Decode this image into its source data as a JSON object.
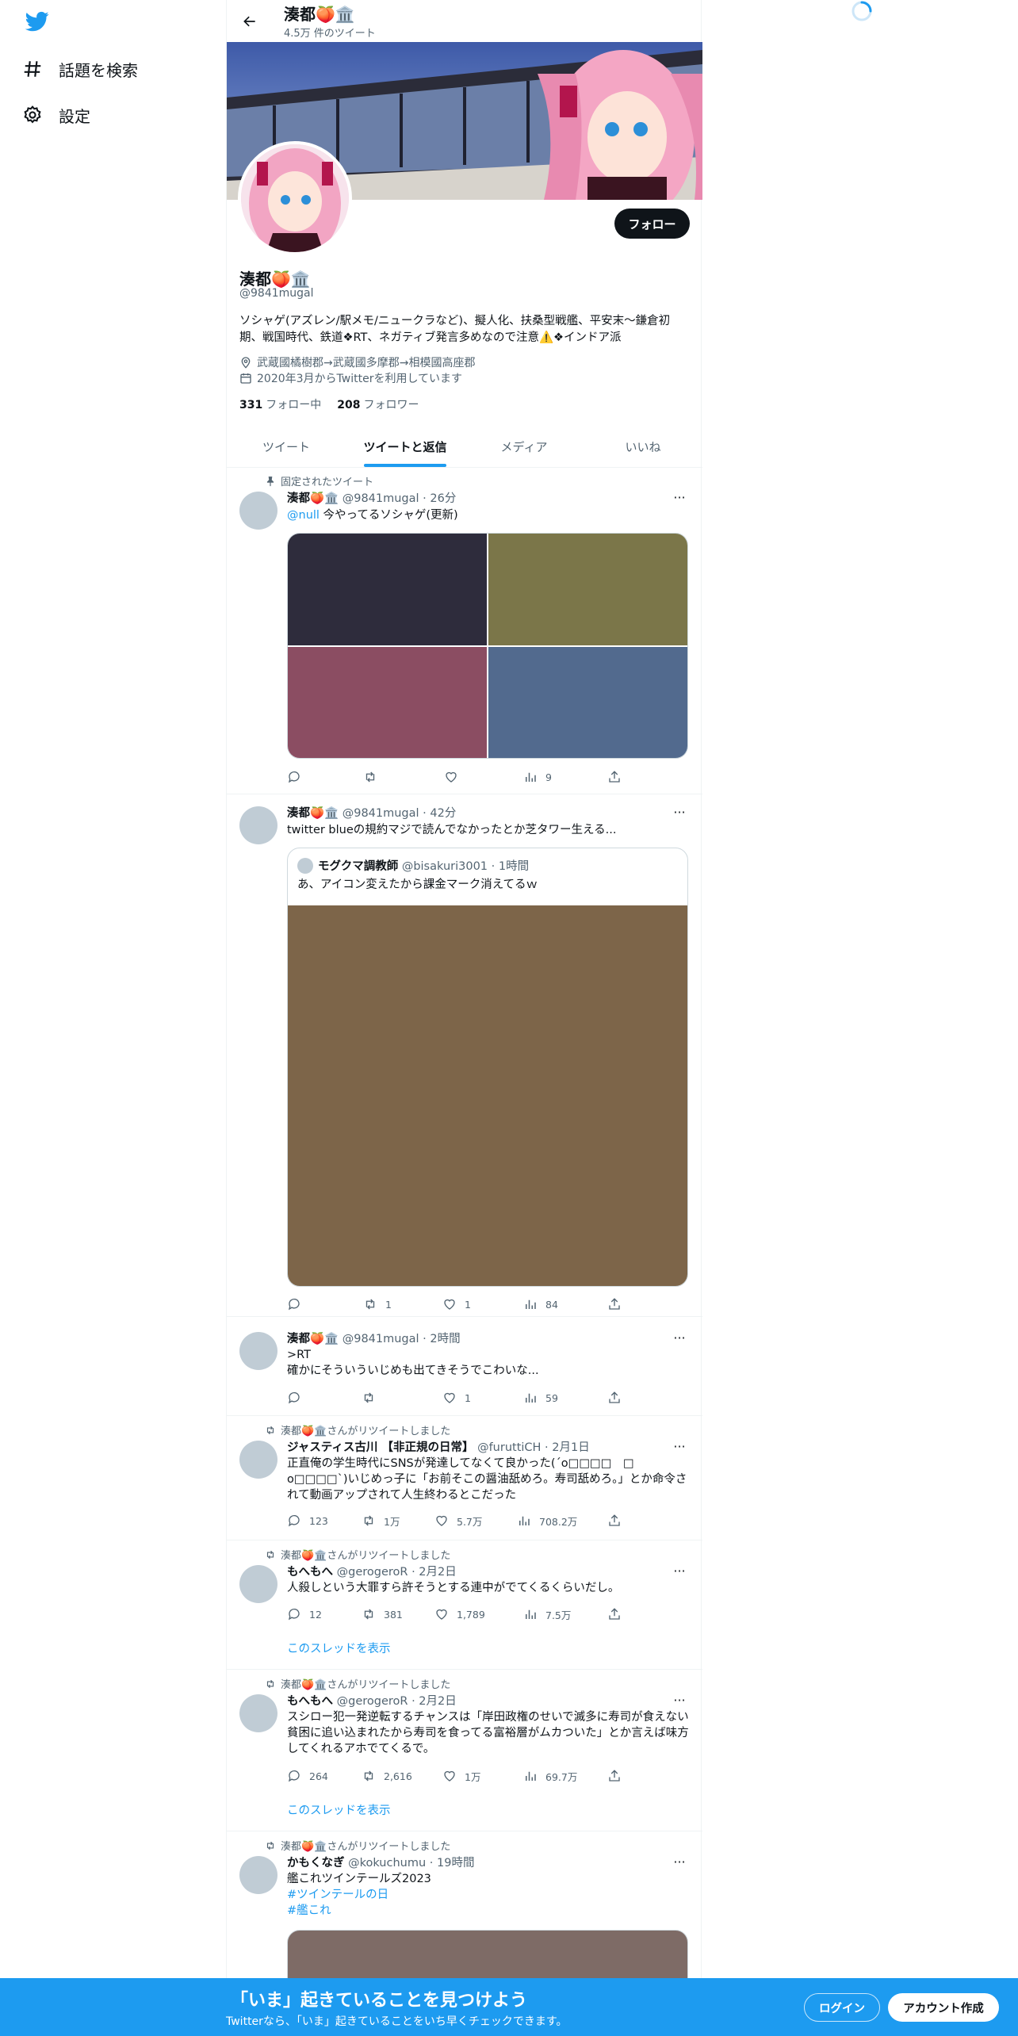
{
  "nav": {
    "explore_label": "話題を検索",
    "settings_label": "設定"
  },
  "profile": {
    "name": "湊都🍑🏛️",
    "tweet_count": "4.5万 件のツイート",
    "handle": "@9841mugal",
    "bio": "ソシャゲ(アズレン/駅メモ/ニュークラなど)、擬人化、扶桑型戦艦、平安末～鎌倉初期、戦国時代、鉄道❖RT、ネガティブ発言多めなので注意⚠️❖インドア派",
    "location": "武蔵國橘樹郡→武蔵國多摩郡→相模國高座郡",
    "joined": "2020年3月からTwitterを利用しています",
    "following_count": "331",
    "following_label": "フォロー中",
    "followers_count": "208",
    "followers_label": "フォロワー",
    "follow_button": "フォロー"
  },
  "tabs": [
    "ツイート",
    "ツイートと返信",
    "メディア",
    "いいね"
  ],
  "active_tab": "ツイートと返信",
  "tweets": [
    {
      "context": "固定されたツイート",
      "name": "湊都🍑🏛️",
      "meta": "@9841mugal · 26分",
      "mention": "@null",
      "text": "今やってるソシャゲ(更新)",
      "media_colors": [
        "#2e2c3c",
        "#7b7649",
        "#8b4d62",
        "#526a8e"
      ],
      "views": "9"
    },
    {
      "name": "湊都🍑🏛️",
      "meta": "@9841mugal · 42分",
      "text": "twitter blueの規約マジで読んでなかったとか芝タワー生える...",
      "quote": {
        "name": "モグクマ調教師",
        "meta": "@bisakuri3001 · 1時間",
        "text": "あ、アイコン変えたから課金マーク消えてるｗ",
        "media_color": "#7d6549"
      },
      "retweets": "1",
      "likes": "1",
      "views": "84"
    },
    {
      "name": "湊都🍑🏛️",
      "meta": "@9841mugal · 2時間",
      "text_1": ">RT",
      "text_2": "確かにそういういじめも出てきそうでこわいな...",
      "likes": "1",
      "views": "59"
    },
    {
      "context": "湊都🍑🏛️さんがリツイートしました",
      "name": "ジャスティス古川 【非正規の日常】",
      "meta": "@furuttiCH · 2月1日",
      "text": "正直俺の学生時代にSNSが発達してなくて良かった(´o□□□□　□ o□□□□`)いじめっ子に「お前そこの醤油舐めろ。寿司舐めろ。」とか命令されて動画アップされて人生終わるとこだった",
      "replies": "123",
      "retweets": "1万",
      "likes": "5.7万",
      "views": "708.2万"
    },
    {
      "context": "湊都🍑🏛️さんがリツイートしました",
      "name": "もへもへ",
      "meta": "@gerogeroR · 2月2日",
      "text": "人殺しという大罪すら許そうとする連中がでてくるくらいだし。",
      "replies": "12",
      "retweets": "381",
      "likes": "1,789",
      "views": "7.5万",
      "show_thread": "このスレッドを表示"
    },
    {
      "context": "湊都🍑🏛️さんがリツイートしました",
      "name": "もへもへ",
      "meta": "@gerogeroR · 2月2日",
      "text": "スシロー犯一発逆転するチャンスは「岸田政権のせいで滅多に寿司が食えない貧困に追い込まれたから寿司を食ってる富裕層がムカついた」とか言えば味方してくれるアホでてくるで。",
      "replies": "264",
      "retweets": "2,616",
      "likes": "1万",
      "views": "69.7万",
      "show_thread": "このスレッドを表示"
    },
    {
      "context": "湊都🍑🏛️さんがリツイートしました",
      "name": "かもくなぎ",
      "meta": "@kokuchumu · 19時間",
      "text": "艦これツインテールズ2023",
      "hashtag_1": "#ツインテールの日",
      "hashtag_2": "#艦これ",
      "media_color": "#7e6b66"
    }
  ],
  "bottom_bar": {
    "title": "「いま」起きていることを見つけよう",
    "subtitle": "Twitterなら、「いま」起きていることをいち早くチェックできます。",
    "login": "ログイン",
    "signup": "アカウント作成"
  },
  "colors": {
    "accent": "#1d9bf0",
    "text": "#0f1419",
    "secondary": "#536471"
  }
}
